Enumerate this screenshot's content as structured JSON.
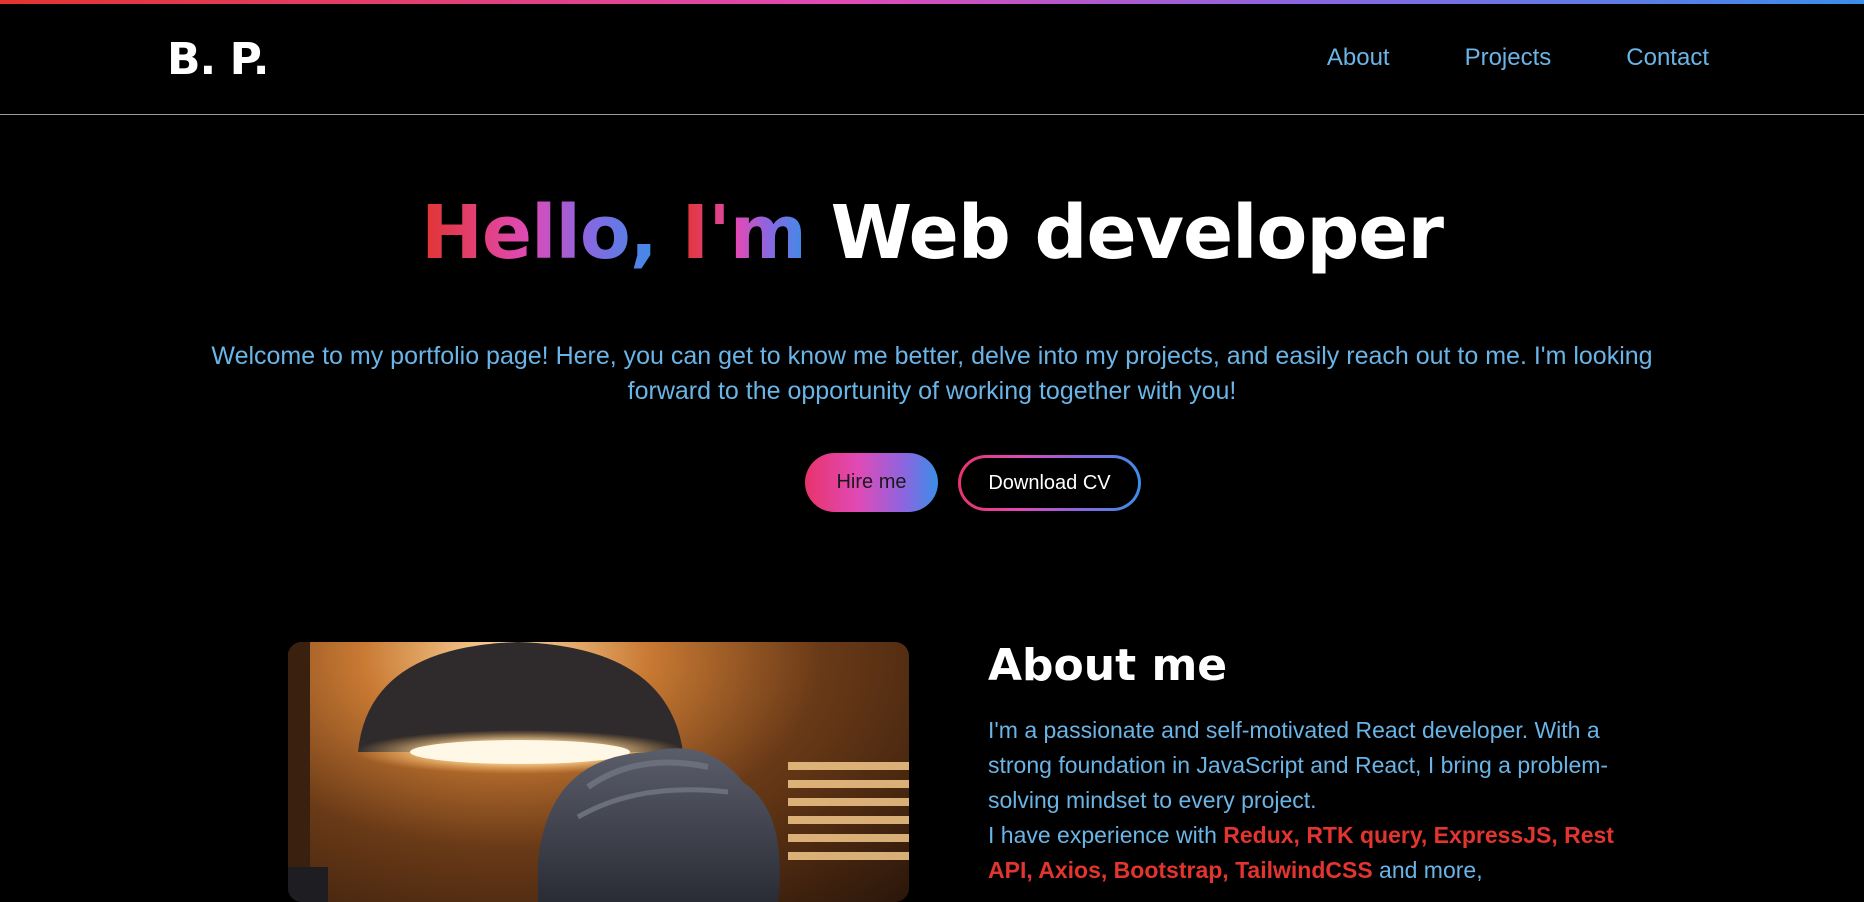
{
  "header": {
    "logo": "B. P.",
    "nav": [
      {
        "label": "About"
      },
      {
        "label": "Projects"
      },
      {
        "label": "Contact"
      }
    ]
  },
  "hero": {
    "title_gradient_1": "Hello,",
    "title_gradient_2": "I'm",
    "title_rest": "Web developer",
    "description": "Welcome to my portfolio page! Here, you can get to know me better, delve into my projects, and easily reach out to me. I'm looking forward to the opportunity of working together with you!",
    "hire_button": "Hire me",
    "cv_button": "Download CV"
  },
  "about": {
    "title": "About me",
    "paragraph1": "I'm a passionate and self-motivated React developer. With a strong foundation in JavaScript and React, I bring a problem-solving mindset to every project.",
    "paragraph2_prefix": "I have experience with",
    "skills": "Redux, RTK query, ExpressJS, Rest API, Axios, Bootstrap, TailwindCSS",
    "paragraph2_suffix": "and more,"
  },
  "colors": {
    "background": "#000000",
    "accent_text": "#6ab4e6",
    "highlight": "#e3342f",
    "gradient_start": "#e3342f",
    "gradient_mid": "#e04ab6",
    "gradient_end": "#3b8ee8"
  }
}
